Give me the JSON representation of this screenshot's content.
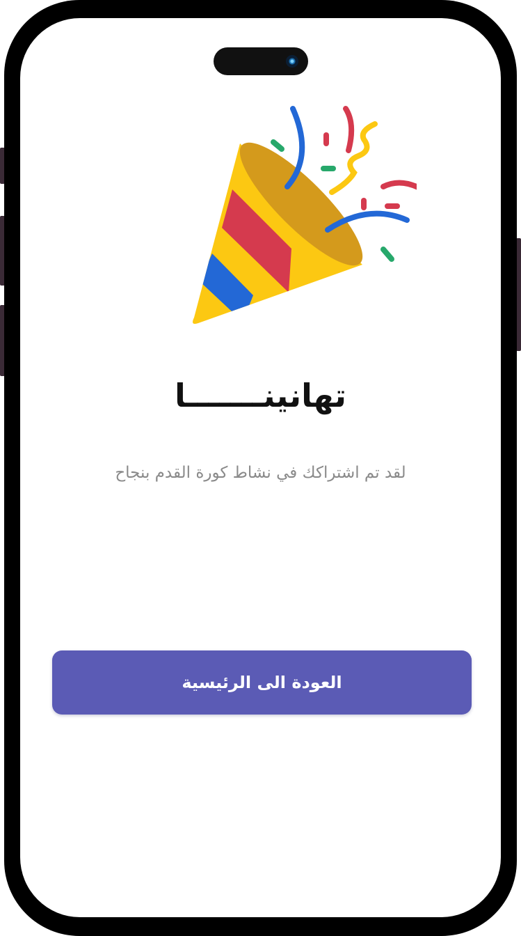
{
  "screen": {
    "title": "تهانينـــــــا",
    "subtitle": "لقد تم اشتراكك في نشاط كورة القدم بنجاح",
    "home_button_label": "العودة الى الرئيسية"
  },
  "illustration": {
    "icon": "party-popper-icon"
  },
  "colors": {
    "accent": "#5b5bb5",
    "title_text": "#111111",
    "subtitle_text": "#8a8a8a",
    "popper_yellow": "#fcc812",
    "popper_red": "#d53a4e",
    "popper_blue": "#2368d6",
    "confetti_green": "#27a86b"
  }
}
